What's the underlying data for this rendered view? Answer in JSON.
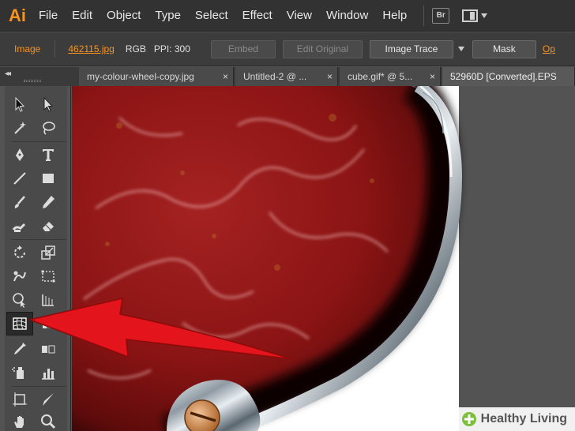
{
  "app": {
    "logo": "Ai"
  },
  "menu": {
    "items": [
      "File",
      "Edit",
      "Object",
      "Type",
      "Select",
      "Effect",
      "View",
      "Window",
      "Help"
    ],
    "bridge": "Br"
  },
  "control_bar": {
    "selection_type": "Image",
    "filename": "462115.jpg",
    "color_mode": "RGB",
    "ppi": "PPI: 300",
    "buttons": [
      "Embed",
      "Edit Original",
      "Image Trace",
      "Mask"
    ],
    "trailing": "Op"
  },
  "tabs": [
    {
      "label": "my-colour-wheel-copy.jpg",
      "close": "×"
    },
    {
      "label": "Untitled-2 @ ...",
      "close": "×"
    },
    {
      "label": "cube.gif* @ 5...",
      "close": "×"
    },
    {
      "label": "52960D [Converted].EPS",
      "close": ""
    }
  ],
  "tools_panel": {
    "collapse": "◂◂",
    "tools": [
      "selection-tool",
      "direct-selection-tool",
      "magic-wand-tool",
      "lasso-tool",
      "pen-tool",
      "type-tool",
      "line-segment-tool",
      "rectangle-tool",
      "paintbrush-tool",
      "pencil-tool",
      "blob-brush-tool",
      "eraser-tool",
      "rotate-tool",
      "scale-tool",
      "warp-tool",
      "free-transform-tool",
      "shape-builder-tool",
      "perspective-grid-tool",
      "mesh-tool",
      "gradient-tool",
      "eyedropper-tool",
      "blend-tool",
      "symbol-sprayer-tool",
      "column-graph-tool",
      "artboard-tool",
      "slice-tool",
      "hand-tool",
      "zoom-tool"
    ],
    "selected_tool": "mesh-tool"
  },
  "annotation": {
    "arrow_color": "#e3141b"
  },
  "colors": {
    "accent": "#f7941d",
    "menubar": "#323232",
    "panel": "#535353",
    "marble_red": "#8b1414"
  },
  "watermark": {
    "text": "Healthy Living"
  }
}
